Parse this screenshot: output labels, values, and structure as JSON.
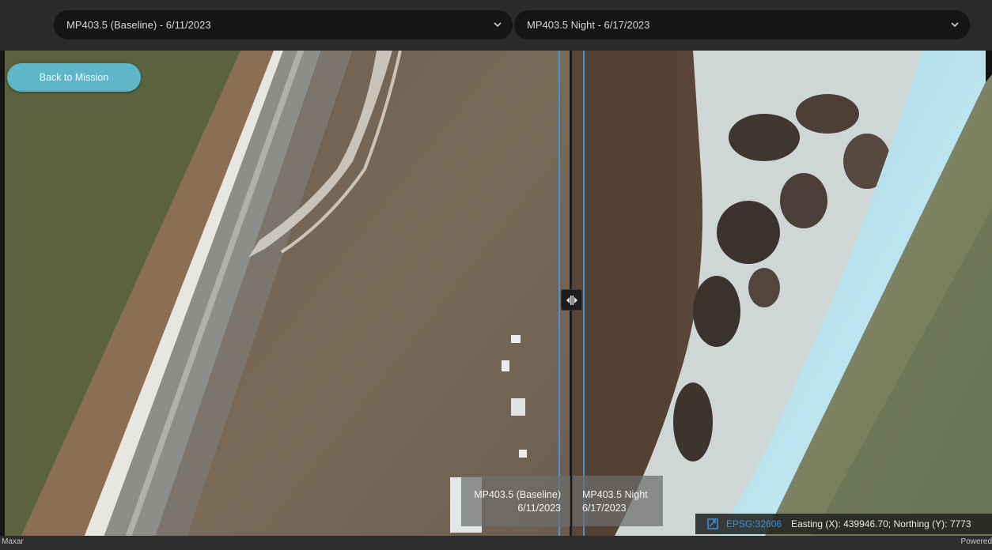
{
  "header": {
    "left_select": {
      "value": "MP403.5 (Baseline) - 6/11/2023",
      "icon": "chevron-down-icon"
    },
    "right_select": {
      "value": "MP403.5 Night - 6/17/2023",
      "icon": "chevron-down-icon"
    }
  },
  "actions": {
    "back_label": "Back to Mission"
  },
  "swipe": {
    "handle_icon": "swipe-handle-icon",
    "left_label": {
      "name": "MP403.5 (Baseline)",
      "date": "6/11/2023"
    },
    "right_label": {
      "name": "MP403.5 Night",
      "date": "6/17/2023"
    }
  },
  "coordinates": {
    "icon": "coordinate-system-icon",
    "epsg": "EPSG:32606",
    "readout": "Easting (X): 439946.70; Northing (Y): 7773"
  },
  "footer": {
    "attribution_left": "Maxar",
    "attribution_right": "Powered"
  },
  "colors": {
    "accent_blue": "#4a90d6",
    "back_button": "#5fb6c9",
    "epsg_link": "#3d8fd1"
  }
}
